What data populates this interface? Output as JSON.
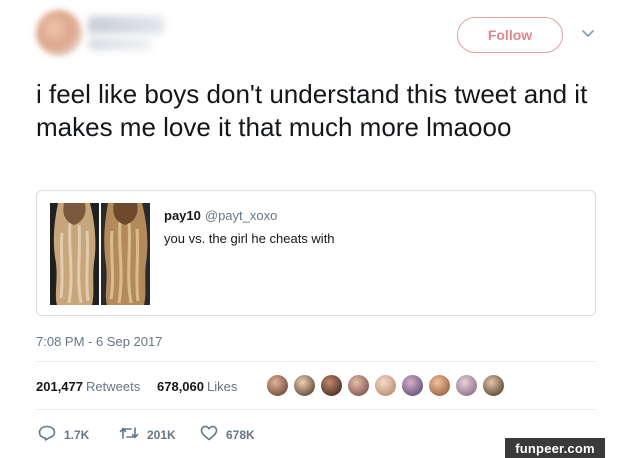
{
  "header": {
    "follow_label": "Follow",
    "icons": {
      "menu": "chevron-down-icon"
    }
  },
  "tweet": {
    "text": "i feel like boys don't understand this tweet and it makes me love it that much more lmaooo",
    "timestamp": "7:08 PM - 6 Sep 2017"
  },
  "quote": {
    "name": "pay10",
    "handle": "@payt_xoxo",
    "text": "you vs. the girl he cheats with"
  },
  "stats": {
    "retweets_count": "201,477",
    "retweets_label": "Retweets",
    "likes_count": "678,060",
    "likes_label": "Likes",
    "liker_avatars": 9
  },
  "actions": {
    "replies": "1.7K",
    "retweets": "201K",
    "likes": "678K",
    "icons": [
      "reply-icon",
      "retweet-icon",
      "heart-icon"
    ]
  },
  "watermark": "funpeer.com",
  "colors": {
    "follow": "#e0868f",
    "secondary_text": "#657786",
    "primary_text": "#14171a"
  }
}
